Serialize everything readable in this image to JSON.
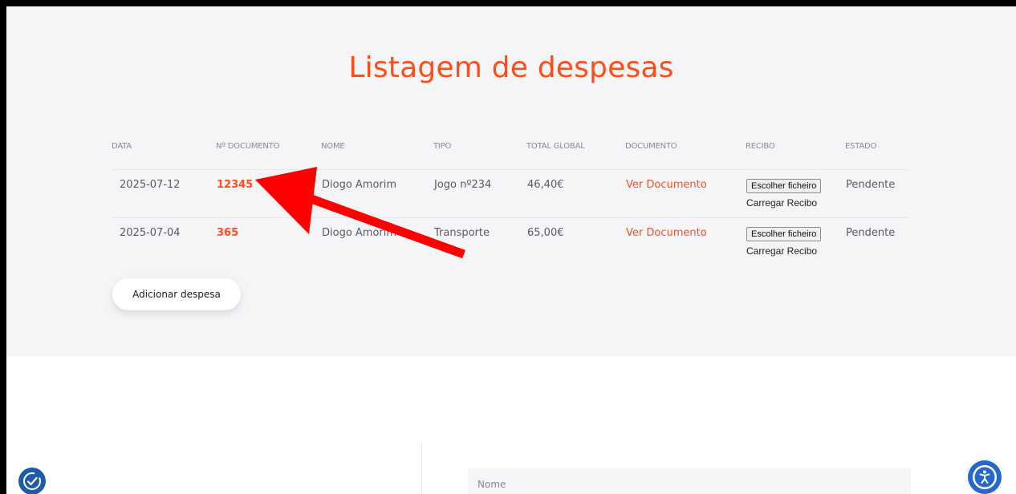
{
  "page": {
    "title": "Listagem de despesas"
  },
  "table": {
    "headers": [
      "DATA",
      "Nº DOCUMENTO",
      "NOME",
      "TIPO",
      "TOTAL GLOBAL",
      "DOCUMENTO",
      "RECIBO",
      "ESTADO"
    ],
    "rows": [
      {
        "date": "2025-07-12",
        "doc_number": "12345",
        "name": "Diogo Amorim",
        "type": "Jogo nº234",
        "total": "46,40€",
        "document": "Ver Documento",
        "receipt_button": "Escolher ficheiro",
        "receipt_upload": "Carregar Recibo",
        "status": "Pendente"
      },
      {
        "date": "2025-07-04",
        "doc_number": "365",
        "name": "Diogo Amorim",
        "type": "Transporte",
        "total": "65,00€",
        "document": "Ver Documento",
        "receipt_button": "Escolher ficheiro",
        "receipt_upload": "Carregar Recibo",
        "status": "Pendente"
      }
    ]
  },
  "actions": {
    "add_expense": "Adicionar despesa"
  },
  "form": {
    "name_placeholder": "Nome"
  },
  "colors": {
    "accent": "#ff4d1a",
    "annotation_arrow": "#ff0000",
    "a11y_blue": "#2667c9"
  },
  "icons": {
    "left_widget": "accessibility-check-icon",
    "right_widget": "accessibility-person-icon",
    "overlay": "red-arrow-annotation"
  }
}
